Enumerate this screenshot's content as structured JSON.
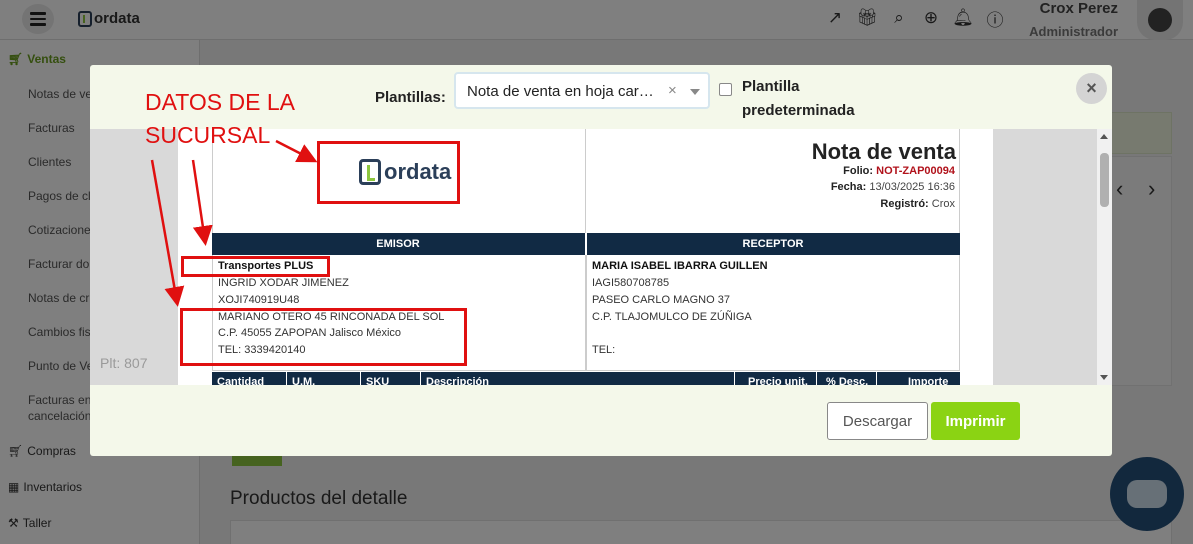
{
  "app": {
    "logo_text": "ordata",
    "user_name": "Crox Perez",
    "user_role": "Administrador",
    "top_icons": [
      "external-link-icon",
      "gift-icon",
      "search-zoom-icon",
      "plus-circle-icon",
      "bell-icon",
      "help-icon"
    ]
  },
  "sidebar": {
    "section_ventas": "Ventas",
    "items": [
      {
        "label": "Notas de ve"
      },
      {
        "label": "Facturas"
      },
      {
        "label": "Clientes"
      },
      {
        "label": "Pagos de cl"
      },
      {
        "label": "Cotizacione"
      },
      {
        "label": "Facturar do"
      },
      {
        "label": "Notas de cr"
      },
      {
        "label": "Cambios fis"
      },
      {
        "label": "Punto de Ve"
      },
      {
        "label": "Facturas en"
      },
      {
        "label": "cancelación"
      }
    ],
    "section_compras": "Compras",
    "section_inventarios": "Inventarios",
    "section_taller": "Taller"
  },
  "main": {
    "section_title": "Productos del detalle"
  },
  "modal": {
    "templates_label": "Plantillas:",
    "template_value": "Nota de venta en hoja car…",
    "clear_symbol": "×",
    "default_template_label": "Plantilla predeterminada",
    "close_symbol": "×",
    "viewer_label": "Plt: 807",
    "download_label": "Descargar",
    "print_label": "Imprimir"
  },
  "document": {
    "logo_text": "ordata",
    "title": "Nota de venta",
    "folio_label": "Folio:",
    "folio_value": "NOT-ZAP00094",
    "fecha_label": "Fecha:",
    "fecha_value": "13/03/2025 16:36",
    "registro_label": "Registró:",
    "registro_value": "Crox",
    "emisor_header": "EMISOR",
    "receptor_header": "RECEPTOR",
    "emisor": {
      "name": "Transportes PLUS",
      "contact": "INGRID XODAR JIMENEZ",
      "rfc": "XOJI740919U48",
      "address": "MARIANO OTERO 45 RINCONADA DEL SOL",
      "cp": "C.P. 45055 ZAPOPAN Jalisco México",
      "tel": "TEL: 3339420140"
    },
    "receptor": {
      "name": "MARIA ISABEL IBARRA GUILLEN",
      "rfc": "IAGI580708785",
      "address": "PASEO CARLO MAGNO 37",
      "cp": "C.P.    TLAJOMULCO DE ZÚÑIGA",
      "tel": "TEL:"
    },
    "columns": [
      "Cantidad",
      "U.M.",
      "SKU",
      "Descripción",
      "Precio unit.",
      "% Desc.",
      "Importe"
    ]
  },
  "annotation": {
    "line1": "DATOS DE LA",
    "line2": "SUCURSAL",
    "color": "#e01010"
  }
}
